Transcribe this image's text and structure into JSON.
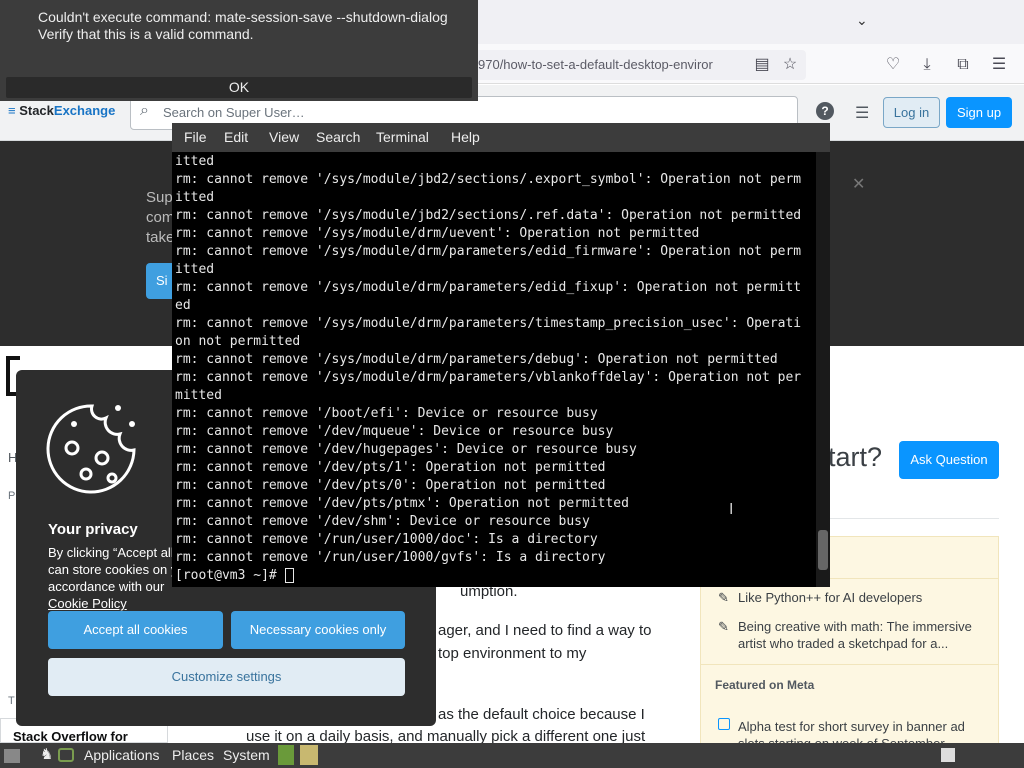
{
  "notification": {
    "message": "Couldn't execute command: mate-session-save --shutdown-dialog\nVerify that this is a valid command.",
    "ok_label": "OK"
  },
  "browser": {
    "url": "970/how-to-set-a-default-desktop-enviror"
  },
  "stackexchange": {
    "logo_stack": "Stack",
    "logo_exchange": "Exchange",
    "search_placeholder": "Search on Super User…",
    "login_label": "Log in",
    "signup_label": "Sign up"
  },
  "terminal": {
    "menu": [
      "File",
      "Edit",
      "View",
      "Search",
      "Terminal",
      "Help"
    ],
    "lines": [
      "itted",
      "rm: cannot remove '/sys/module/jbd2/sections/.export_symbol': Operation not perm",
      "itted",
      "rm: cannot remove '/sys/module/jbd2/sections/.ref.data': Operation not permitted",
      "rm: cannot remove '/sys/module/drm/uevent': Operation not permitted",
      "rm: cannot remove '/sys/module/drm/parameters/edid_firmware': Operation not perm",
      "itted",
      "rm: cannot remove '/sys/module/drm/parameters/edid_fixup': Operation not permitt",
      "ed",
      "rm: cannot remove '/sys/module/drm/parameters/timestamp_precision_usec': Operati",
      "on not permitted",
      "rm: cannot remove '/sys/module/drm/parameters/debug': Operation not permitted",
      "rm: cannot remove '/sys/module/drm/parameters/vblankoffdelay': Operation not per",
      "mitted",
      "rm: cannot remove '/boot/efi': Device or resource busy",
      "rm: cannot remove '/dev/mqueue': Device or resource busy",
      "rm: cannot remove '/dev/hugepages': Device or resource busy",
      "rm: cannot remove '/dev/pts/1': Operation not permitted",
      "rm: cannot remove '/dev/pts/0': Operation not permitted",
      "rm: cannot remove '/dev/pts/ptmx': Operation not permitted",
      "rm: cannot remove '/dev/shm': Device or resource busy",
      "rm: cannot remove '/run/user/1000/doc': Is a directory",
      "rm: cannot remove '/run/user/1000/gvfs': Is a directory"
    ],
    "prompt": "[root@vm3 ~]# "
  },
  "page": {
    "question_title_fragment": "tart?",
    "ask_label": "Ask Question",
    "sidebar_items": [
      "Like Python++ for AI developers",
      "Being creative with math: The immersive artist who traded a sketchpad for a..."
    ],
    "featured_meta": "Featured on Meta",
    "meta_item": "Alpha test for short survey in banner ad slots starting on week of September",
    "body_1": "umption.",
    "body_2": "ager, and I need to find a way to",
    "body_3": "top environment to my",
    "body_4": "as the default choice because I",
    "body_5": "use it on a daily basis, and manually pick a different one just",
    "stack_overflow_for": "Stack Overflow for"
  },
  "cookie": {
    "title": "Your privacy",
    "text": "By clicking “Accept all can store cookies on y accordance with our",
    "policy_link": "Cookie Policy",
    "accept_label": "Accept all cookies",
    "necessary_label": "Necessary cookies only",
    "customize_label": "Customize settings"
  },
  "taskbar": {
    "applications": "Applications",
    "places": "Places",
    "system": "System"
  }
}
